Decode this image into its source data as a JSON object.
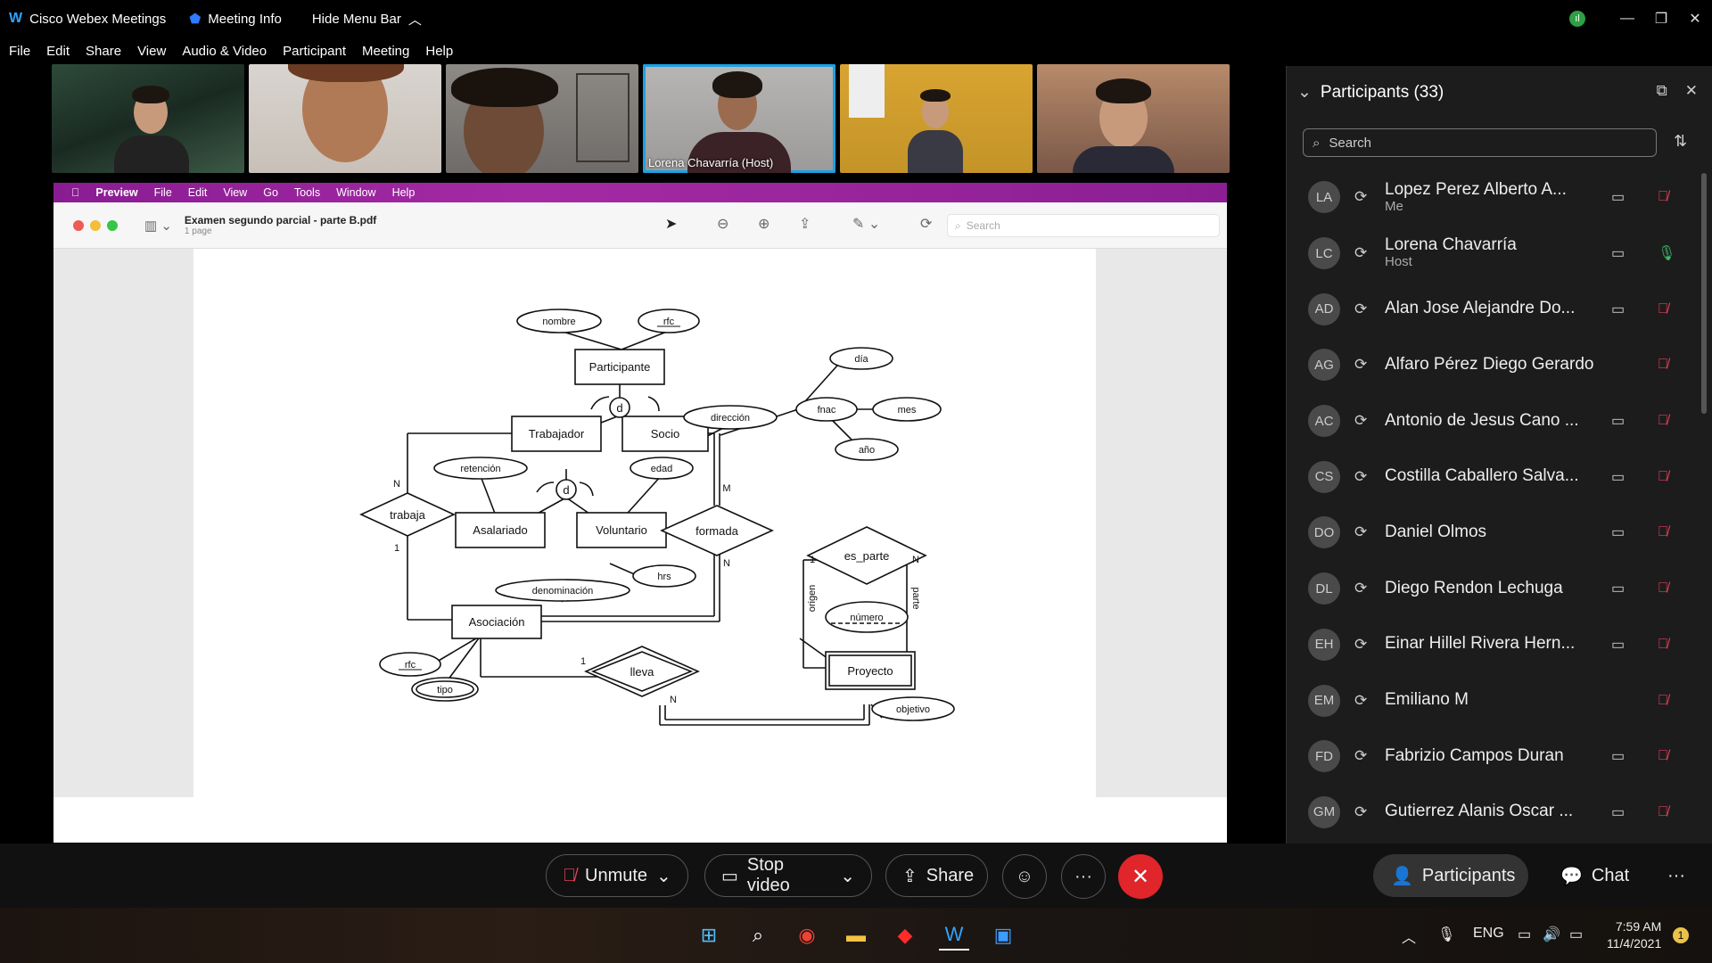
{
  "titlebar": {
    "app_title": "Cisco Webex Meetings",
    "meeting_info": "Meeting Info",
    "hide_menu_bar": "Hide Menu Bar"
  },
  "menu": [
    "File",
    "Edit",
    "Share",
    "View",
    "Audio & Video",
    "Participant",
    "Meeting",
    "Help"
  ],
  "videos": [
    {
      "name": ""
    },
    {
      "name": ""
    },
    {
      "name": ""
    },
    {
      "name": "Lorena Chavarría  (Host)"
    },
    {
      "name": ""
    },
    {
      "name": ""
    }
  ],
  "shared_screen": {
    "mac_menu": {
      "app": "Preview",
      "items": [
        "File",
        "Edit",
        "View",
        "Go",
        "Tools",
        "Window",
        "Help"
      ]
    },
    "document": {
      "title": "Examen segundo parcial - parte  B.pdf",
      "pages": "1 page"
    },
    "search_placeholder": "Search",
    "diagram": {
      "entities": [
        "Participante",
        "Trabajador",
        "Socio",
        "Asalariado",
        "Voluntario",
        "Asociación",
        "Proyecto"
      ],
      "relationships": [
        "trabaja",
        "formada",
        "lleva",
        "es_parte"
      ],
      "attributes": [
        "nombre",
        "rfc",
        "dirección",
        "día",
        "fnac",
        "mes",
        "año",
        "retención",
        "edad",
        "hrs",
        "denominación",
        "rfc",
        "tipo",
        "número",
        "objetivo"
      ],
      "disjoint_marker": "d",
      "cardinalities": {
        "trabaja_top": "N",
        "trabaja_bottom": "1",
        "formada_top": "M",
        "formada_bottom": "N",
        "lleva_left": "1",
        "lleva_bottom": "N",
        "es_parte_left": "1",
        "es_parte_right": "N"
      },
      "role_labels": [
        "origen",
        "parte"
      ]
    }
  },
  "participants_panel": {
    "title": "Participants (33)",
    "search_placeholder": "Search",
    "list": [
      {
        "initials": "LA",
        "name": "Lopez Perez Alberto A...",
        "role": "Me",
        "camera": true,
        "mic": "muted"
      },
      {
        "initials": "LC",
        "name": "Lorena Chavarría",
        "role": "Host",
        "camera": true,
        "mic": "on"
      },
      {
        "initials": "AD",
        "name": "Alan Jose Alejandre Do...",
        "role": "",
        "camera": true,
        "mic": "muted"
      },
      {
        "initials": "AG",
        "name": "Alfaro Pérez Diego Gerardo",
        "role": "",
        "camera": false,
        "mic": "muted"
      },
      {
        "initials": "AC",
        "name": "Antonio de Jesus Cano ...",
        "role": "",
        "camera": true,
        "mic": "muted"
      },
      {
        "initials": "CS",
        "name": "Costilla Caballero Salva...",
        "role": "",
        "camera": true,
        "mic": "muted"
      },
      {
        "initials": "DO",
        "name": "Daniel Olmos",
        "role": "",
        "camera": true,
        "mic": "muted"
      },
      {
        "initials": "DL",
        "name": "Diego Rendon Lechuga",
        "role": "",
        "camera": true,
        "mic": "muted"
      },
      {
        "initials": "EH",
        "name": "Einar Hillel Rivera Hern...",
        "role": "",
        "camera": true,
        "mic": "muted"
      },
      {
        "initials": "EM",
        "name": "Emiliano M",
        "role": "",
        "camera": false,
        "mic": "muted"
      },
      {
        "initials": "FD",
        "name": "Fabrizio Campos Duran",
        "role": "",
        "camera": true,
        "mic": "muted"
      },
      {
        "initials": "GM",
        "name": "Gutierrez Alanis Oscar ...",
        "role": "",
        "camera": true,
        "mic": "muted"
      }
    ]
  },
  "controls": {
    "unmute": "Unmute",
    "stop_video": "Stop video",
    "share": "Share",
    "participants": "Participants",
    "chat": "Chat"
  },
  "taskbar": {
    "language": "ENG",
    "time": "7:59 AM",
    "date": "11/4/2021",
    "notification_count": "1"
  }
}
